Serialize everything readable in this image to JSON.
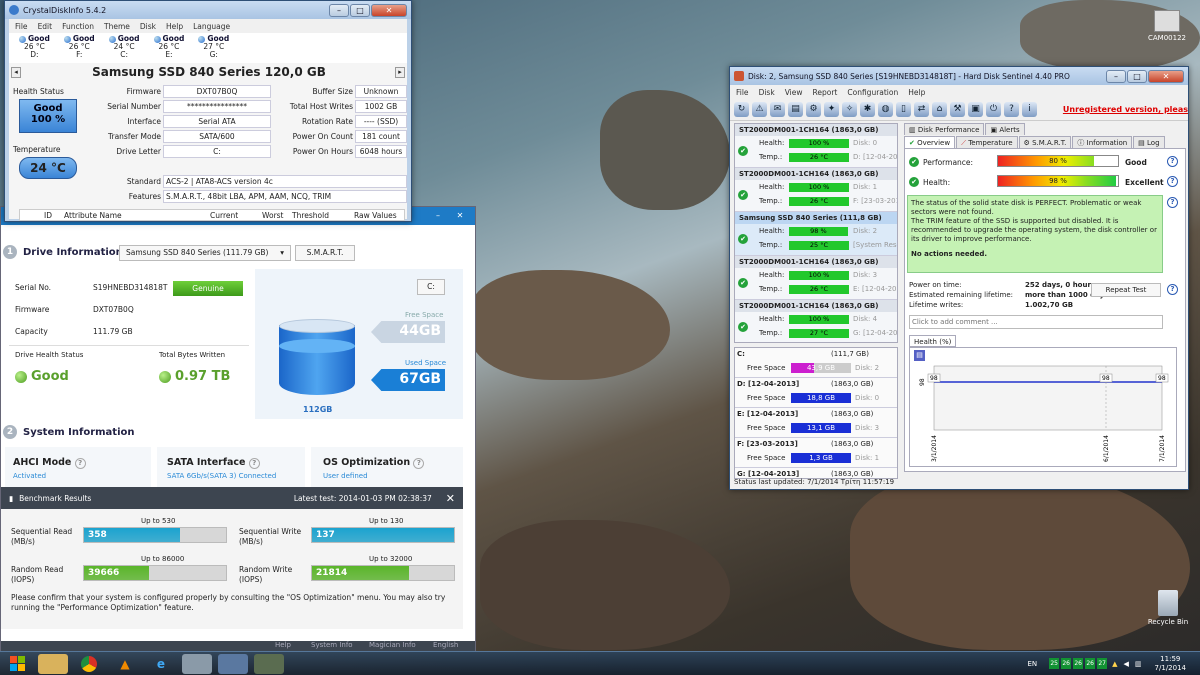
{
  "desktop": {
    "cam_label": "CAM00122",
    "recycle_label": "Recycle Bin"
  },
  "cdi": {
    "title": "CrystalDiskInfo 5.4.2",
    "menu": [
      "File",
      "Edit",
      "Function",
      "Theme",
      "Disk",
      "Help",
      "Language"
    ],
    "drives": [
      {
        "status": "Good",
        "temp": "26 °C",
        "letter": "D:"
      },
      {
        "status": "Good",
        "temp": "26 °C",
        "letter": "F:"
      },
      {
        "status": "Good",
        "temp": "24 °C",
        "letter": "C:"
      },
      {
        "status": "Good",
        "temp": "26 °C",
        "letter": "E:"
      },
      {
        "status": "Good",
        "temp": "27 °C",
        "letter": "G:"
      }
    ],
    "disk_title": "Samsung SSD 840 Series  120,0 GB",
    "health_status_label": "Health Status",
    "health_value": "Good",
    "health_pct": "100 %",
    "temperature_label": "Temperature",
    "temperature_value": "24 °C",
    "left_fields": [
      {
        "label": "Firmware",
        "value": "DXT07B0Q"
      },
      {
        "label": "Serial Number",
        "value": "****************"
      },
      {
        "label": "Interface",
        "value": "Serial ATA"
      },
      {
        "label": "Transfer Mode",
        "value": "SATA/600"
      },
      {
        "label": "Drive Letter",
        "value": "C:"
      }
    ],
    "right_fields": [
      {
        "label": "Buffer Size",
        "value": "Unknown"
      },
      {
        "label": "Total Host Writes",
        "value": "1002 GB"
      },
      {
        "label": "Rotation Rate",
        "value": "---- (SSD)"
      },
      {
        "label": "Power On Count",
        "value": "181 count"
      },
      {
        "label": "Power On Hours",
        "value": "6048 hours"
      }
    ],
    "standard_label": "Standard",
    "standard_value": "ACS-2 | ATA8-ACS version 4c",
    "features_label": "Features",
    "features_value": "S.M.A.R.T., 48bit LBA, APM, AAM, NCQ, TRIM",
    "table_headers": [
      "ID",
      "Attribute Name",
      "Current",
      "Worst",
      "Threshold",
      "Raw Values"
    ]
  },
  "magician": {
    "drive_info_title": "Drive Information",
    "drive_select": "Samsung SSD 840 Series (111.79 GB)",
    "smart_button": "S.M.A.R.T.",
    "serial_label": "Serial No.",
    "serial_value": "S19HNEBD314818T",
    "genuine_button": "Genuine",
    "firmware_label": "Firmware",
    "firmware_value": "DXT07B0Q",
    "capacity_label": "Capacity",
    "capacity_value": "111.79 GB",
    "health_label": "Drive Health Status",
    "health_value": "Good",
    "tbw_label": "Total Bytes Written",
    "tbw_value": "0.97 TB",
    "drive_letter": "C:",
    "free_space_label": "Free Space",
    "free_space_value": "44GB",
    "used_space_label": "Used Space",
    "used_space_value": "67GB",
    "total_value": "112GB",
    "system_info_title": "System Information",
    "ahci_title": "AHCI Mode",
    "ahci_value": "Activated",
    "sata_title": "SATA Interface",
    "sata_value": "SATA 6Gb/s(SATA 3) Connected",
    "os_title": "OS Optimization",
    "os_value": "User defined",
    "bench_title": "Benchmark Results",
    "bench_latest": "Latest test: 2014-01-03 PM 02:38:37",
    "bench": [
      {
        "label": "Sequential Read",
        "unit": "(MB/s)",
        "value": "358",
        "max_label": "Up to 530",
        "fraction": 0.675,
        "color": "#1ba3cf"
      },
      {
        "label": "Sequential Write",
        "unit": "(MB/s)",
        "value": "137",
        "max_label": "Up to 130",
        "fraction": 1.0,
        "color": "#1ba3cf"
      },
      {
        "label": "Random Read",
        "unit": "(IOPS)",
        "value": "39666",
        "max_label": "Up to 86000",
        "fraction": 0.461,
        "color": "#5ab52a"
      },
      {
        "label": "Random Write",
        "unit": "(IOPS)",
        "value": "21814",
        "max_label": "Up to 32000",
        "fraction": 0.682,
        "color": "#5ab52a"
      }
    ],
    "bench_note": "Please confirm that your system is configured properly by consulting the \"OS Optimization\" menu. You may also try running the \"Performance Optimization\" feature.",
    "footer": [
      "Help",
      "System Info",
      "Magician Info",
      "English"
    ]
  },
  "hds": {
    "title": "Disk: 2, Samsung SSD 840 Series [S19HNEBD314818T]  -  Hard Disk Sentinel 4.40 PRO",
    "menu": [
      "File",
      "Disk",
      "View",
      "Report",
      "Configuration",
      "Help"
    ],
    "unregistered": "Unregistered version, pleas",
    "disks": [
      {
        "name": "ST2000DM001-1CH164 (1863,0 GB)",
        "health": "100 %",
        "health_frac": 1.0,
        "temp": "26 °C",
        "info1": "Disk: 0",
        "info2": "D: [12-04-201"
      },
      {
        "name": "ST2000DM001-1CH164 (1863,0 GB)",
        "health": "100 %",
        "health_frac": 1.0,
        "temp": "26 °C",
        "info1": "Disk: 1",
        "info2": "F: [23-03-2013"
      },
      {
        "name": "Samsung SSD 840 Series (111,8 GB)",
        "health": "98 %",
        "health_frac": 0.98,
        "temp": "25 °C",
        "info1": "Disk: 2",
        "info2": "[System Rese"
      },
      {
        "name": "ST2000DM001-1CH164 (1863,0 GB)",
        "health": "100 %",
        "health_frac": 1.0,
        "temp": "26 °C",
        "info1": "Disk: 3",
        "info2": "E: [12-04-2013"
      },
      {
        "name": "ST2000DM001-1CH164 (1863,0 GB)",
        "health": "100 %",
        "health_frac": 1.0,
        "temp": "27 °C",
        "info1": "Disk: 4",
        "info2": "G: [12-04-2013"
      }
    ],
    "health_label": "Health:",
    "temp_label": "Temp.:",
    "partitions": [
      {
        "name": "C:",
        "size": "(111,7 GB)",
        "free": "43,9 GB",
        "disk": "Disk: 2",
        "color": "#cc1fcf",
        "fraction": 0.39
      },
      {
        "name": "D: [12-04-2013]",
        "size": "(1863,0 GB)",
        "free": "18,8 GB",
        "disk": "Disk: 0",
        "color": "#1a2fd6",
        "fraction": 1.0
      },
      {
        "name": "E: [12-04-2013]",
        "size": "(1863,0 GB)",
        "free": "13,1 GB",
        "disk": "Disk: 3",
        "color": "#1a2fd6",
        "fraction": 1.0
      },
      {
        "name": "F: [23-03-2013]",
        "size": "(1863,0 GB)",
        "free": "1,3 GB",
        "disk": "Disk: 1",
        "color": "#1a2fd6",
        "fraction": 1.0
      },
      {
        "name": "G: [12-04-2013]",
        "size": "(1863,0 GB)",
        "free": "",
        "disk": "",
        "color": "#1a2fd6",
        "fraction": 1.0
      }
    ],
    "free_space_label": "Free Space",
    "tabs_top": [
      "Disk Performance",
      "Alerts"
    ],
    "tabs": [
      "Overview",
      "Temperature",
      "S.M.A.R.T.",
      "Information",
      "Log"
    ],
    "performance_label": "Performance:",
    "performance_value": "80 %",
    "performance_frac": 0.8,
    "performance_text": "Good",
    "health_pct": "98 %",
    "health_frac": 0.98,
    "health_text": "Excellent",
    "status_text": "The status of the solid state disk is PERFECT. Problematic or weak sectors were not found.\nThe TRIM feature of the SSD is supported but disabled. It is recommended to upgrade the operating system, the disk controller or its driver to improve performance.",
    "no_actions": "No actions needed.",
    "power_on_label": "Power on time:",
    "power_on_value": "252 days, 0 hours",
    "remaining_label": "Estimated remaining lifetime:",
    "remaining_value": "more than 1000 days",
    "writes_label": "Lifetime writes:",
    "writes_value": "1.002,70 GB",
    "repeat_test": "Repeat Test",
    "comment_placeholder": "Click to add comment ...",
    "health_chart_tab": "Health (%)",
    "chart_y_label": "98",
    "chart_points": [
      "98",
      "98",
      "98"
    ],
    "chart_x_labels": [
      "3/1/2014",
      "6/1/2014",
      "7/1/2014"
    ],
    "statusbar": "Status last updated: 7/1/2014 Τρίτη 11:57:19"
  },
  "taskbar": {
    "lang": "EN",
    "tray_temps": [
      "25",
      "26",
      "26",
      "26",
      "27"
    ],
    "time": "11:59",
    "date": "7/1/2014"
  }
}
